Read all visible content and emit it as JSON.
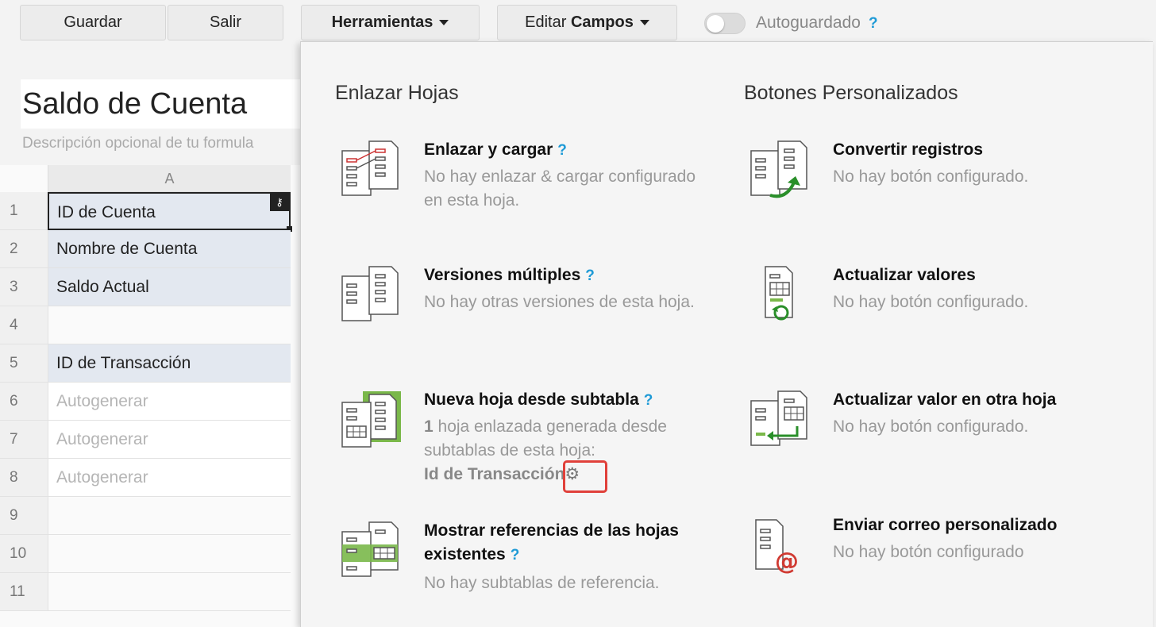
{
  "toolbar": {
    "save_label": "Guardar",
    "exit_label": "Salir",
    "tools_label": "Herramientas",
    "edit_prefix": "Editar",
    "edit_bold": "Campos",
    "autosave_label": "Autoguardado",
    "help_mark": "?"
  },
  "form": {
    "title": "Saldo de Cuenta",
    "description": "Descripción opcional de tu formula"
  },
  "grid": {
    "column_header": "A",
    "key_icon": "key-icon",
    "rows": [
      {
        "num": "1",
        "value": "ID de Cuenta",
        "kind": "field"
      },
      {
        "num": "2",
        "value": "Nombre de Cuenta",
        "kind": "field"
      },
      {
        "num": "3",
        "value": "Saldo Actual",
        "kind": "field"
      },
      {
        "num": "4",
        "value": "",
        "kind": "empty"
      },
      {
        "num": "5",
        "value": "ID de Transacción",
        "kind": "field"
      },
      {
        "num": "6",
        "value": "Autogenerar",
        "kind": "placeholder"
      },
      {
        "num": "7",
        "value": "Autogenerar",
        "kind": "placeholder"
      },
      {
        "num": "8",
        "value": "Autogenerar",
        "kind": "placeholder"
      },
      {
        "num": "9",
        "value": "",
        "kind": "empty"
      },
      {
        "num": "10",
        "value": "",
        "kind": "empty"
      },
      {
        "num": "11",
        "value": "",
        "kind": "empty"
      }
    ]
  },
  "panel": {
    "link_section_title": "Enlazar Hojas",
    "buttons_section_title": "Botones Personalizados",
    "link_tools": [
      {
        "name": "Enlazar y cargar",
        "help": "?",
        "desc": "No hay enlazar & cargar configurado en esta hoja."
      },
      {
        "name": "Versiones múltiples",
        "help": "?",
        "desc": "No hay otras versiones de esta hoja."
      },
      {
        "name": "Nueva hoja desde subtabla",
        "help": "?",
        "count": "1",
        "desc": " hoja enlazada generada desde subtablas de esta hoja:",
        "linked_sheet": "Id de Transacción",
        "gear_icon": "gear-icon"
      },
      {
        "name": "Mostrar referencias de las hojas existentes",
        "help": "?",
        "desc": "No hay subtablas de referencia."
      }
    ],
    "button_tools": [
      {
        "name": "Convertir registros",
        "desc": "No hay botón configurado."
      },
      {
        "name": "Actualizar valores",
        "desc": "No hay botón configurado."
      },
      {
        "name": "Actualizar valor en otra hoja",
        "desc": "No hay botón configurado."
      },
      {
        "name": "Enviar correo personalizado",
        "desc": "No hay botón configurado"
      }
    ]
  },
  "colors": {
    "accent_help": "#1e9ad6",
    "highlight": "#e0403a",
    "field_bg": "#e3e8f0",
    "icon_green": "#7ab84a"
  }
}
